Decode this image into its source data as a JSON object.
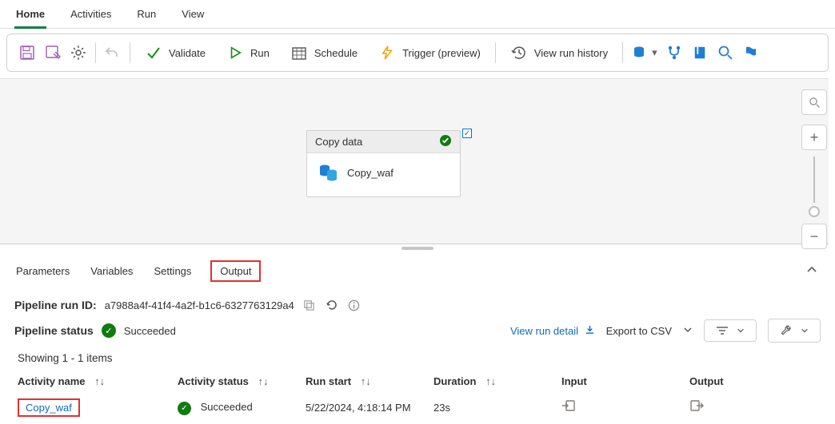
{
  "tabs": {
    "items": [
      "Home",
      "Activities",
      "Run",
      "View"
    ],
    "active": "Home"
  },
  "toolbar": {
    "validate": "Validate",
    "run": "Run",
    "schedule": "Schedule",
    "trigger": "Trigger (preview)",
    "history": "View run history"
  },
  "canvas": {
    "node": {
      "title": "Copy data",
      "name": "Copy_waf"
    }
  },
  "subtabs": {
    "items": [
      "Parameters",
      "Variables",
      "Settings",
      "Output"
    ],
    "active": "Output"
  },
  "runinfo": {
    "run_id_label": "Pipeline run ID:",
    "run_id": "a7988a4f-41f4-4a2f-b1c6-6327763129a4",
    "status_label": "Pipeline status",
    "status_text": "Succeeded",
    "view_detail": "View run detail",
    "export": "Export to CSV"
  },
  "table": {
    "showing": "Showing 1 - 1 items",
    "columns": {
      "name": "Activity name",
      "status": "Activity status",
      "start": "Run start",
      "duration": "Duration",
      "input": "Input",
      "output": "Output"
    },
    "rows": [
      {
        "name": "Copy_waf",
        "status": "Succeeded",
        "start": "5/22/2024, 4:18:14 PM",
        "duration": "23s"
      }
    ]
  }
}
